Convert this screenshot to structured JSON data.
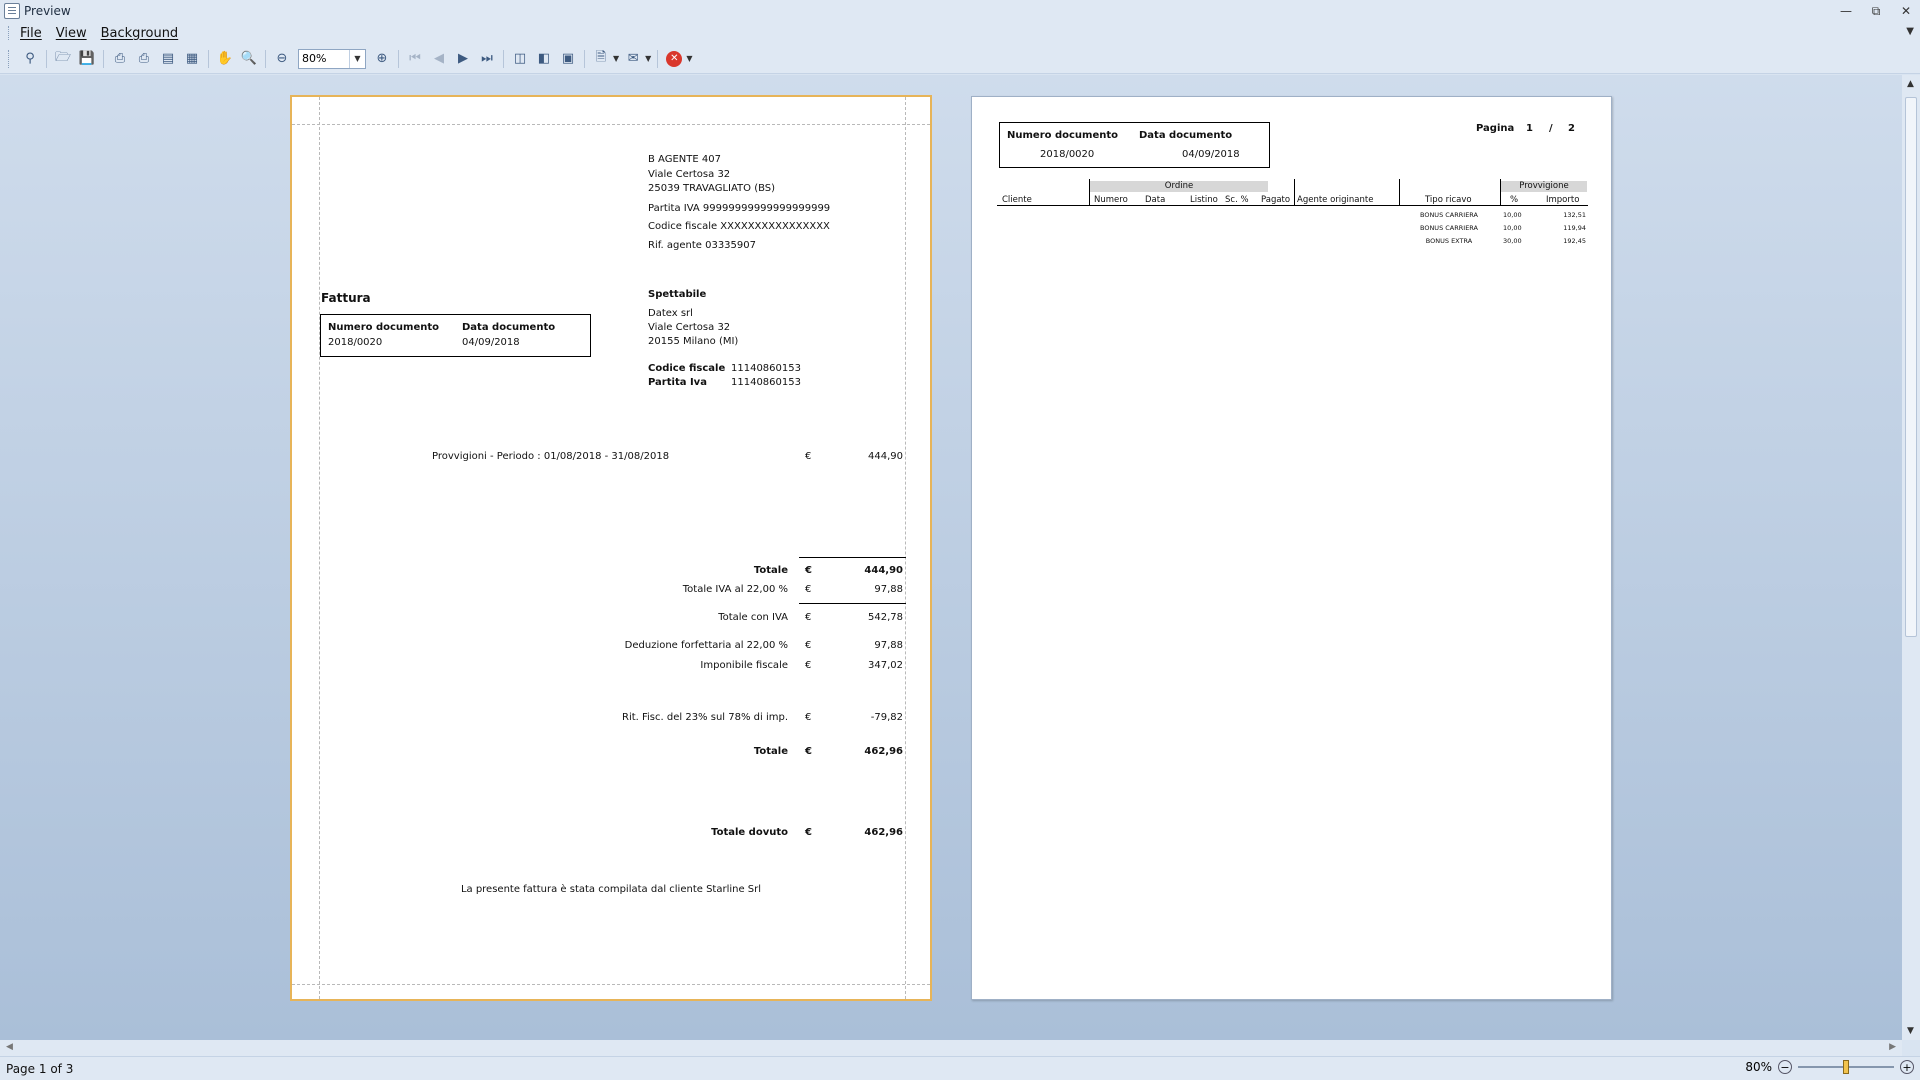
{
  "window": {
    "title": "Preview"
  },
  "menu": {
    "items": [
      "File",
      "View",
      "Background"
    ]
  },
  "toolbar": {
    "zoom_value": "80%"
  },
  "status": {
    "page_info": "Page 1 of 3",
    "zoom": "80%",
    "zoom_level": 0.5
  },
  "invoice": {
    "agent": {
      "name": "B AGENTE 407",
      "address": "Viale Certosa 32",
      "city": "25039 TRAVAGLIATO (BS)",
      "vat": "Partita IVA 99999999999999999999",
      "tax_code": "Codice fiscale XXXXXXXXXXXXXXXX",
      "agent_ref": "Rif. agente 03335907"
    },
    "doc_type": "Fattura",
    "doc_number_label": "Numero documento",
    "doc_date_label": "Data documento",
    "doc_number": "2018/0020",
    "doc_date": "04/09/2018",
    "recipient_label": "Spettabile",
    "recipient": {
      "name": "Datex srl",
      "address": "Viale Certosa 32",
      "city": "20155 Milano (MI)",
      "tax_code_label": "Codice fiscale",
      "tax_code": "11140860153",
      "vat_label": "Partita Iva",
      "vat": "11140860153"
    },
    "line_desc": "Provvigioni - Periodo : 01/08/2018 - 31/08/2018",
    "currency": "€",
    "line_amount": "444,90",
    "totals": [
      {
        "label": "Totale",
        "amount": "444,90",
        "bold": true
      },
      {
        "label": "Totale IVA al 22,00 %",
        "amount": "97,88",
        "bold": false
      },
      {
        "label": "Totale con IVA",
        "amount": "542,78",
        "bold": false
      },
      {
        "label": "Deduzione forfettaria al 22,00 %",
        "amount": "97,88",
        "bold": false
      },
      {
        "label": "Imponibile fiscale",
        "amount": "347,02",
        "bold": false
      },
      {
        "label": "Rit. Fisc. del 23% sul 78% di imp.",
        "amount": "-79,82",
        "bold": false
      },
      {
        "label": "Totale",
        "amount": "462,96",
        "bold": true
      },
      {
        "label": "Totale dovuto",
        "amount": "462,96",
        "bold": true
      }
    ],
    "footer_note": "La presente fattura è stata compilata dal cliente Starline Srl"
  },
  "detail": {
    "doc_number_label": "Numero documento",
    "doc_date_label": "Data documento",
    "doc_number": "2018/0020",
    "doc_date": "04/09/2018",
    "page_label": "Pagina",
    "page_current": "1",
    "page_sep": "/",
    "page_total": "2",
    "group_order": "Ordine",
    "group_commission": "Provvigione",
    "columns": [
      "Cliente",
      "Numero",
      "Data",
      "Listino",
      "Sc. %",
      "Pagato",
      "Agente originante",
      "Tipo ricavo",
      "%",
      "Importo"
    ],
    "rows": [
      {
        "tipo": "BONUS CARRIERA",
        "perc": "10,00",
        "importo": "132,51"
      },
      {
        "tipo": "BONUS CARRIERA",
        "perc": "10,00",
        "importo": "119,94"
      },
      {
        "tipo": "BONUS EXTRA",
        "perc": "30,00",
        "importo": "192,45"
      }
    ]
  }
}
